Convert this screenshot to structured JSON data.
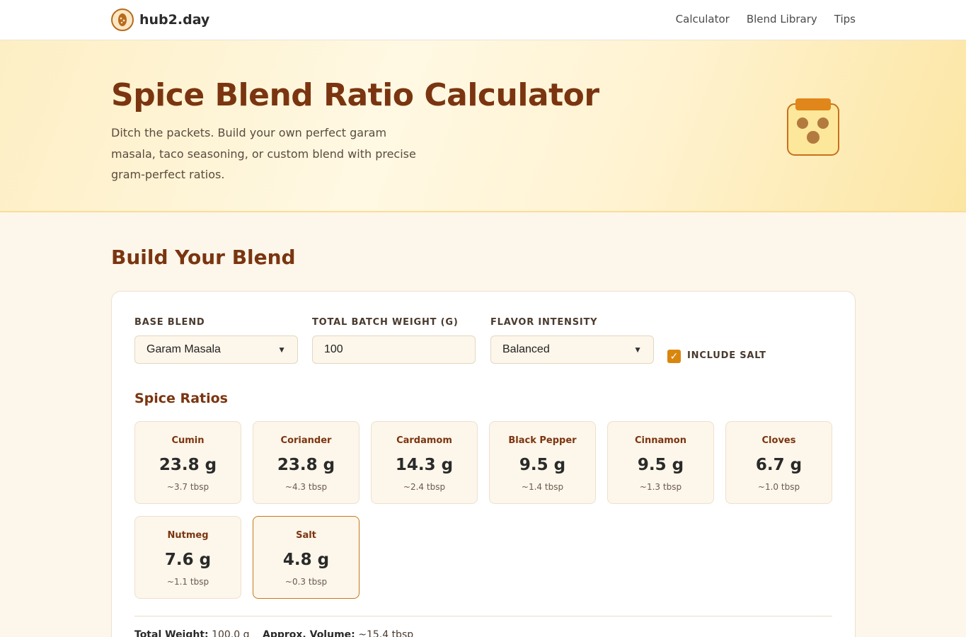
{
  "site": {
    "name": "hub2.day",
    "nav": [
      "Calculator",
      "Blend Library",
      "Tips"
    ]
  },
  "hero": {
    "title": "Spice Blend Ratio Calculator",
    "subtitle": "Ditch the packets. Build your own perfect garam masala, taco seasoning, or custom blend with precise gram-perfect ratios."
  },
  "builder": {
    "title": "Build Your Blend",
    "base_blend": {
      "label": "BASE BLEND",
      "value": "Garam Masala"
    },
    "batch_weight": {
      "label": "TOTAL BATCH WEIGHT (G)",
      "value": "100"
    },
    "intensity": {
      "label": "FLAVOR INTENSITY",
      "value": "Balanced"
    },
    "include_salt": {
      "label": "INCLUDE SALT",
      "checked": true
    },
    "ratios_title": "Spice Ratios",
    "spices": [
      {
        "name": "Cumin",
        "grams": "23.8 g",
        "tbsp": "~3.7 tbsp"
      },
      {
        "name": "Coriander",
        "grams": "23.8 g",
        "tbsp": "~4.3 tbsp"
      },
      {
        "name": "Cardamom",
        "grams": "14.3 g",
        "tbsp": "~2.4 tbsp"
      },
      {
        "name": "Black Pepper",
        "grams": "9.5 g",
        "tbsp": "~1.4 tbsp"
      },
      {
        "name": "Cinnamon",
        "grams": "9.5 g",
        "tbsp": "~1.3 tbsp"
      },
      {
        "name": "Cloves",
        "grams": "6.7 g",
        "tbsp": "~1.0 tbsp"
      },
      {
        "name": "Nutmeg",
        "grams": "7.6 g",
        "tbsp": "~1.1 tbsp"
      },
      {
        "name": "Salt",
        "grams": "4.8 g",
        "tbsp": "~0.3 tbsp"
      }
    ],
    "summary": {
      "total_label": "Total Weight:",
      "total_value": "100.0 g",
      "volume_label": "Approx. Volume:",
      "volume_value": "~15.4 tbsp"
    }
  },
  "colors": {
    "accent": "#7a3510",
    "checkbox": "#d9860f",
    "background": "#fdf6ea"
  }
}
